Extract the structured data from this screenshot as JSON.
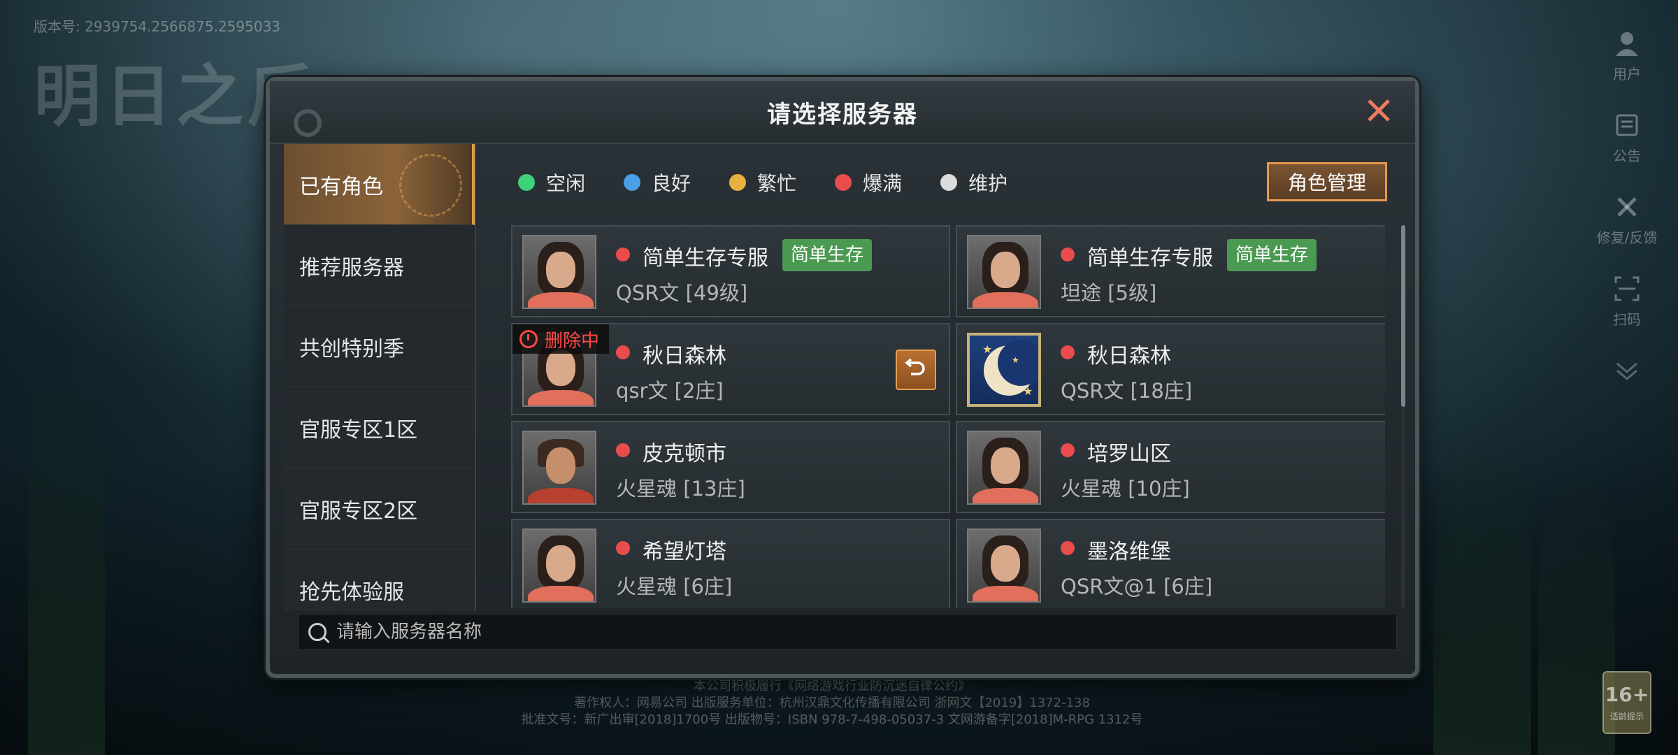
{
  "version_text": "版本号: 2939754.2566875.2595033",
  "logo_text": "明日之后",
  "side_menu": [
    {
      "label": "用户",
      "icon": "user-icon"
    },
    {
      "label": "公告",
      "icon": "notice-icon"
    },
    {
      "label": "修复/反馈",
      "icon": "repair-icon"
    },
    {
      "label": "扫码",
      "icon": "scan-icon"
    },
    {
      "label": "",
      "icon": "chevron-down-icon"
    }
  ],
  "age_badge": {
    "value": "16+",
    "caption": "适龄提示"
  },
  "legal": [
    "本公司积极履行《网络游戏行业防沉迷自律公约》",
    "著作权人：网易公司    出版服务单位：杭州汉鼎文化传播有限公司    浙网文【2019】1372-138",
    "批准文号：新广出审[2018]1700号    出版物号：ISBN 978-7-498-05037-3    文网游备字[2018]M-RPG 1312号"
  ],
  "dialog": {
    "title": "请选择服务器",
    "manage_button": "角色管理",
    "search_placeholder": "请输入服务器名称"
  },
  "tabs": [
    {
      "label": "已有角色",
      "active": true
    },
    {
      "label": "推荐服务器",
      "active": false
    },
    {
      "label": "共创特别季",
      "active": false
    },
    {
      "label": "官服专区1区",
      "active": false
    },
    {
      "label": "官服专区2区",
      "active": false
    },
    {
      "label": "抢先体验服",
      "active": false
    }
  ],
  "legend": [
    {
      "label": "空闲",
      "color": "#3fd07a"
    },
    {
      "label": "良好",
      "color": "#4a9fe6"
    },
    {
      "label": "繁忙",
      "color": "#e8b040"
    },
    {
      "label": "爆满",
      "color": "#e84c4c"
    },
    {
      "label": "维护",
      "color": "#dcdcdc"
    }
  ],
  "servers": [
    {
      "name": "简单生存专服",
      "tag": "简单生存",
      "role": "QSR文",
      "level": "[49级]",
      "status_color": "#e84c4c",
      "avatar": "female"
    },
    {
      "name": "简单生存专服",
      "tag": "简单生存",
      "role": "坦途",
      "level": "[5级]",
      "status_color": "#e84c4c",
      "avatar": "female"
    },
    {
      "name": "秋日森林",
      "tag": "",
      "role": "qsr文",
      "level": "[2庄]",
      "status_color": "#e84c4c",
      "avatar": "female",
      "deleting": "删除中"
    },
    {
      "name": "秋日森林",
      "tag": "",
      "role": "QSR文",
      "level": "[18庄]",
      "status_color": "#e84c4c",
      "avatar": "moon"
    },
    {
      "name": "皮克顿市",
      "tag": "",
      "role": "火星魂",
      "level": "[13庄]",
      "status_color": "#e84c4c",
      "avatar": "male"
    },
    {
      "name": "培罗山区",
      "tag": "",
      "role": "火星魂",
      "level": "[10庄]",
      "status_color": "#e84c4c",
      "avatar": "female"
    },
    {
      "name": "希望灯塔",
      "tag": "",
      "role": "火星魂",
      "level": "[6庄]",
      "status_color": "#e84c4c",
      "avatar": "female"
    },
    {
      "name": "墨洛维堡",
      "tag": "",
      "role": "QSR文@1",
      "level": "[6庄]",
      "status_color": "#e84c4c",
      "avatar": "female2"
    }
  ]
}
